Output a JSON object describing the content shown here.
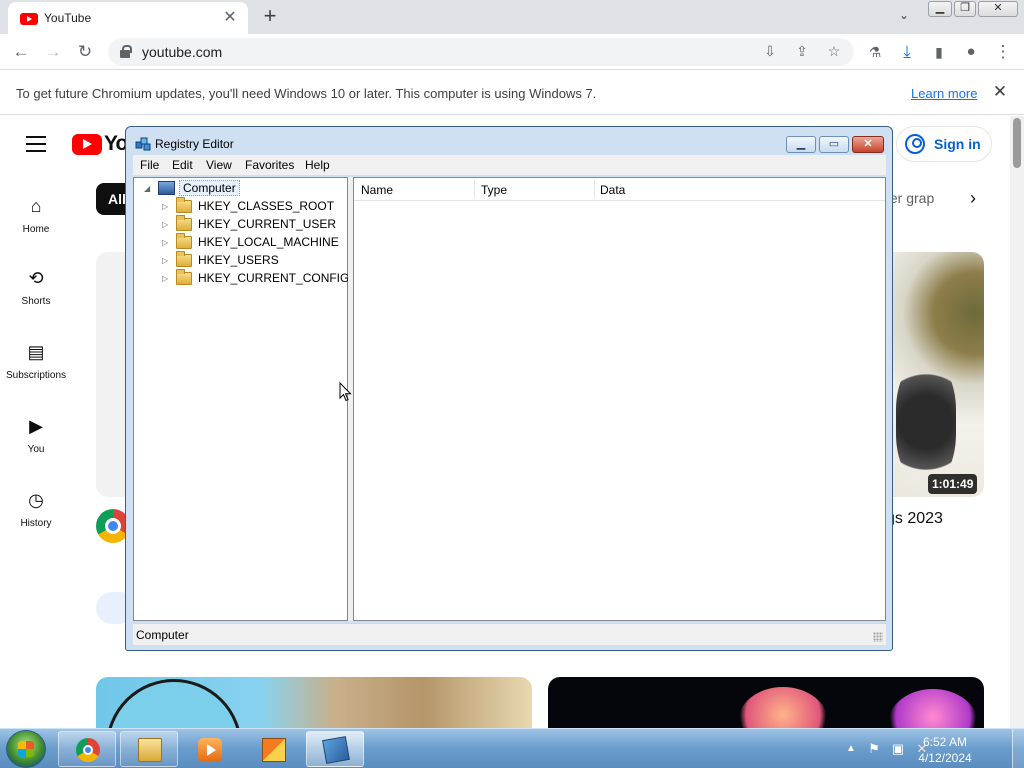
{
  "browser": {
    "tab_title": "YouTube",
    "tab_close": "✕",
    "new_tab": "+",
    "tab_search": "⌄",
    "url": "youtube.com",
    "infobar_message": "To get future Chromium updates, you'll need Windows 10 or later. This computer is using Windows 7.",
    "infobar_link": "Learn more",
    "infobar_close": "✕"
  },
  "youtube": {
    "logo_text": "You",
    "chip_all": "All",
    "chip_partial": "ter grap",
    "sign_in": "Sign in",
    "sidebar": [
      {
        "label": "Home",
        "icon": "home-icon"
      },
      {
        "label": "Shorts",
        "icon": "shorts-icon"
      },
      {
        "label": "Subscriptions",
        "icon": "subscriptions-icon"
      },
      {
        "label": "You",
        "icon": "you-icon"
      },
      {
        "label": "History",
        "icon": "history-icon"
      }
    ],
    "video_duration": "1:01:49",
    "video_title_partial": "gs 2023"
  },
  "regedit": {
    "title": "Registry Editor",
    "menu": [
      "File",
      "Edit",
      "View",
      "Favorites",
      "Help"
    ],
    "tree_root": "Computer",
    "hives": [
      "HKEY_CLASSES_ROOT",
      "HKEY_CURRENT_USER",
      "HKEY_LOCAL_MACHINE",
      "HKEY_USERS",
      "HKEY_CURRENT_CONFIG"
    ],
    "columns": [
      "Name",
      "Type",
      "Data"
    ],
    "status": "Computer"
  },
  "taskbar": {
    "time": "6:52 AM",
    "date": "4/12/2024"
  }
}
